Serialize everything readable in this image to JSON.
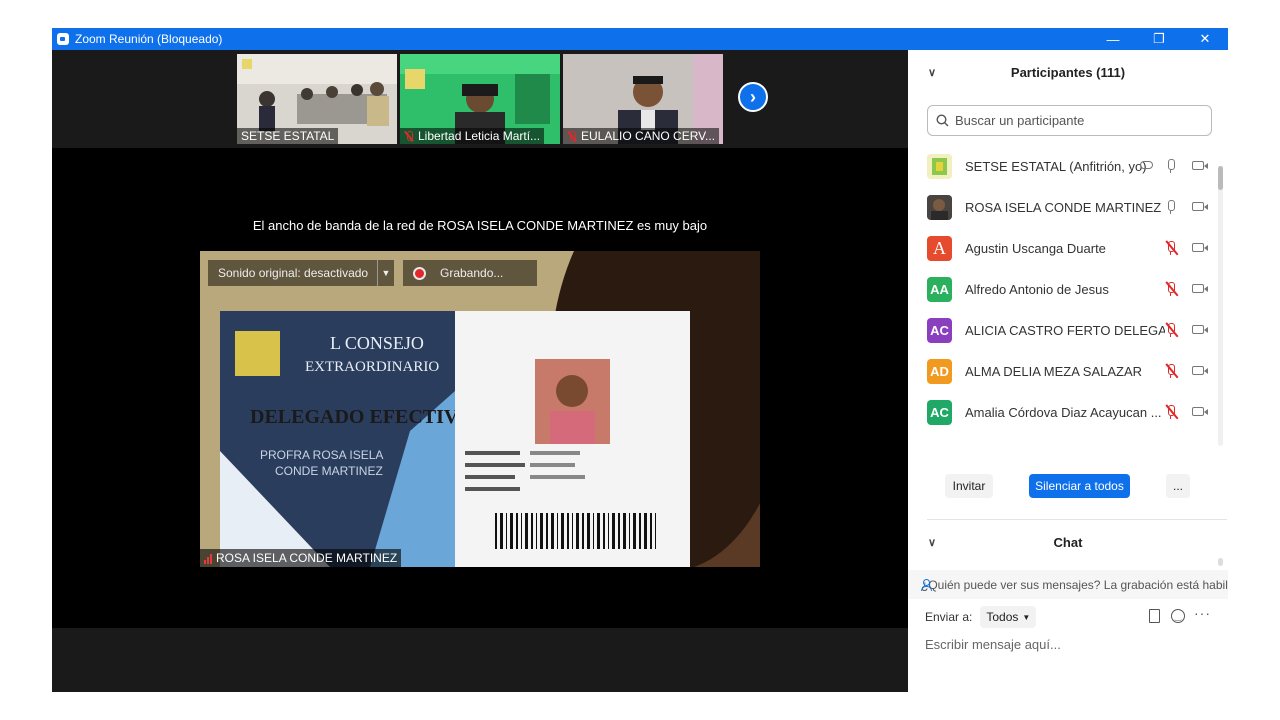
{
  "window": {
    "title": "Zoom Reunión (Bloqueado)",
    "minimize_glyph": "—",
    "restore_glyph": "❐",
    "close_glyph": "✕"
  },
  "thumbnails": [
    {
      "name": "SETSE ESTATAL",
      "muted": false
    },
    {
      "name": "Libertad Leticia Martí...",
      "muted": true
    },
    {
      "name": "EULALIO CANO CERV...",
      "muted": true
    }
  ],
  "stage": {
    "next_glyph": "›",
    "bandwidth_message": "El ancho de banda de la red de ROSA ISELA CONDE MARTINEZ es muy bajo",
    "original_sound": "Sonido original: desactivado",
    "recording": "Grabando...",
    "speaker_name": "ROSA ISELA CONDE MARTINEZ"
  },
  "participants": {
    "header": "Participantes (111)",
    "search_placeholder": "Buscar un participante",
    "list": [
      {
        "name": "SETSE ESTATAL (Anfitrión, yo)",
        "initials": "",
        "color": "#e7e2a8",
        "muted": false,
        "cloud": true
      },
      {
        "name": "ROSA ISELA CONDE MARTINEZ",
        "initials": "",
        "color": "#6b6257",
        "muted": false,
        "cloud": false
      },
      {
        "name": "Agustin Uscanga Duarte",
        "initials": "A",
        "color": "#e54b2c",
        "muted": true,
        "cloud": false
      },
      {
        "name": "Alfredo Antonio de Jesus",
        "initials": "AA",
        "color": "#2bb05e",
        "muted": true,
        "cloud": false
      },
      {
        "name": "ALICIA CASTRO FERTO DELEGAC...",
        "initials": "AC",
        "color": "#8a3fbf",
        "muted": true,
        "cloud": false
      },
      {
        "name": "ALMA DELIA MEZA SALAZAR",
        "initials": "AD",
        "color": "#f29a1f",
        "muted": true,
        "cloud": false
      },
      {
        "name": "Amalia Córdova Diaz Acayucan ...",
        "initials": "AC",
        "color": "#1fa866",
        "muted": true,
        "cloud": false
      },
      {
        "name": "",
        "initials": "",
        "color": "#e05a1f",
        "muted": false,
        "cloud": false
      }
    ],
    "invite_button": "Invitar",
    "mute_all_button": "Silenciar a todos",
    "more_button": "..."
  },
  "chat": {
    "header": "Chat",
    "info": "¿Quién puede ver sus mensajes? La grabación está habilitada",
    "send_to_label": "Enviar a:",
    "send_to_value": "Todos",
    "input_placeholder": "Escribir mensaje aquí..."
  },
  "colors": {
    "accent": "#0e71eb",
    "muted_red": "#e02828"
  }
}
